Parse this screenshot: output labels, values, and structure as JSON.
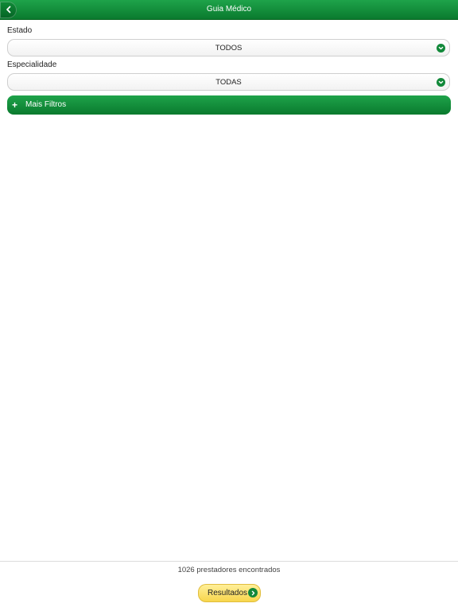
{
  "header": {
    "title": "Guia Médico",
    "back_icon": "chevron-left-icon"
  },
  "form": {
    "estado": {
      "label": "Estado",
      "value": "TODOS"
    },
    "especialidade": {
      "label": "Especialidade",
      "value": "TODAS"
    },
    "more_filters": {
      "icon": "plus",
      "label": "Mais Filtros"
    }
  },
  "footer": {
    "count_text": "1026 prestadores encontrados",
    "results_label": "Resultados",
    "results_icon": "arrow-right-circle-icon"
  },
  "colors": {
    "brand_green": "#0f8a37",
    "button_yellow": "#f8d64c"
  }
}
